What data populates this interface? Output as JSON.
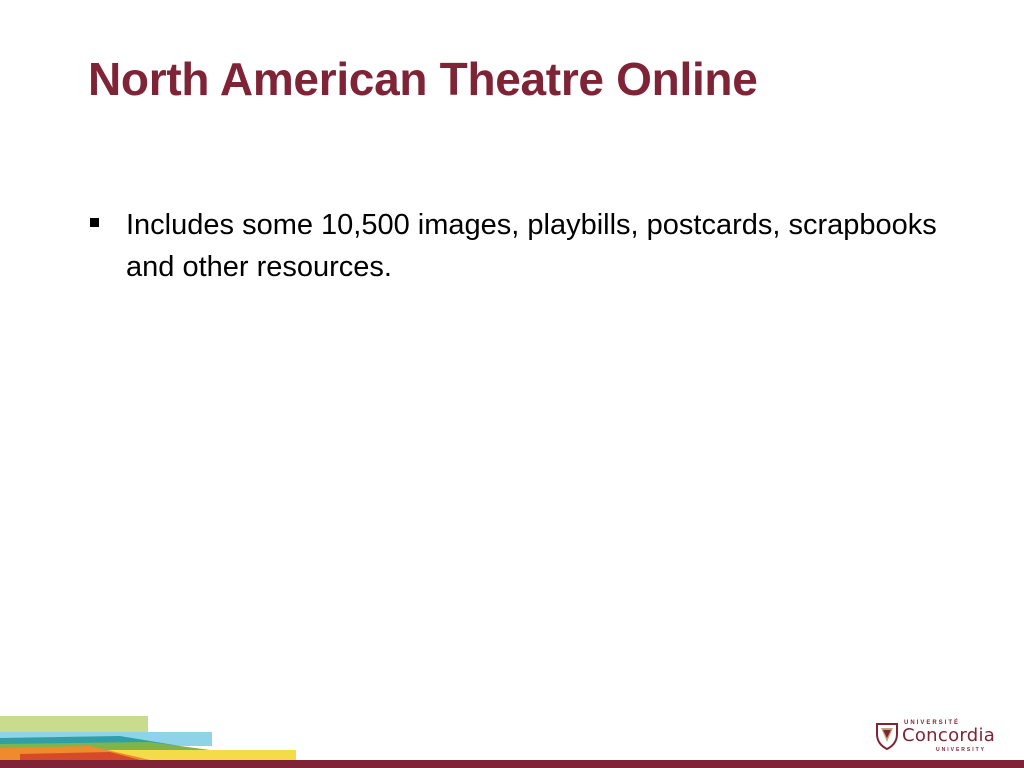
{
  "slide": {
    "title": "North American Theatre Online",
    "bullets": [
      "Includes some 10,500 images, playbills, postcards, scrapbooks and other resources."
    ]
  },
  "logo": {
    "top_text": "UNIVERSITÉ",
    "name": "Concordia",
    "bottom_text": "UNIVERSITY",
    "icon": "concordia-shield-icon"
  },
  "colors": {
    "brand": "#7f2437",
    "text": "#000000",
    "background": "#ffffff"
  }
}
